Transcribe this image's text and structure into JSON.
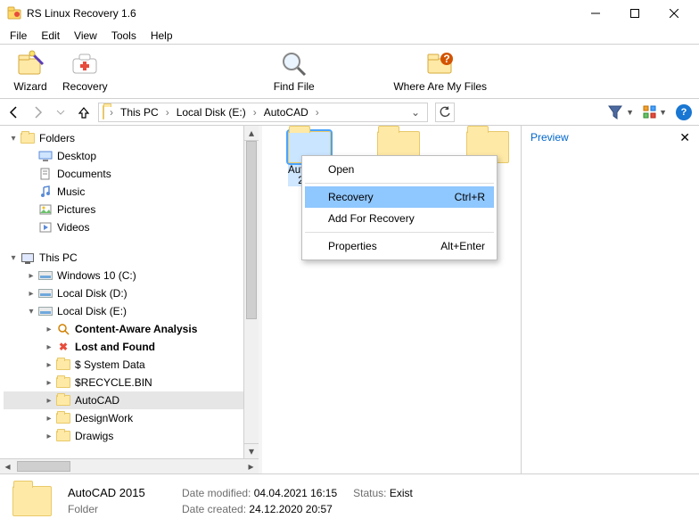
{
  "title": "RS Linux Recovery 1.6",
  "menubar": [
    "File",
    "Edit",
    "View",
    "Tools",
    "Help"
  ],
  "toolbar": [
    {
      "id": "wizard",
      "label": "Wizard"
    },
    {
      "id": "recovery",
      "label": "Recovery"
    },
    {
      "id": "findfile",
      "label": "Find File"
    },
    {
      "id": "wherefiles",
      "label": "Where Are My Files"
    }
  ],
  "breadcrumb": [
    "This PC",
    "Local Disk (E:)",
    "AutoCAD"
  ],
  "tree": {
    "folders_root": "Folders",
    "quick": [
      "Desktop",
      "Documents",
      "Music",
      "Pictures",
      "Videos"
    ],
    "thispc": "This PC",
    "drives": [
      "Windows 10 (C:)",
      "Local Disk (D:)",
      "Local Disk (E:)"
    ],
    "e_children": [
      {
        "label": "Content-Aware Analysis",
        "bold": true,
        "icon": "search"
      },
      {
        "label": "Lost and Found",
        "bold": true,
        "icon": "x"
      },
      {
        "label": "$ System Data",
        "icon": "folder"
      },
      {
        "label": "$RECYCLE.BIN",
        "icon": "folder"
      },
      {
        "label": "AutoCAD",
        "icon": "folder",
        "selected": true
      },
      {
        "label": "DesignWork",
        "icon": "folder"
      },
      {
        "label": "Drawigs",
        "icon": "folder"
      }
    ]
  },
  "thumbs": [
    {
      "label": "AutoCAD\n2015",
      "selected": true
    },
    {
      "label": ""
    },
    {
      "label": ""
    }
  ],
  "context_menu": {
    "items": [
      {
        "label": "Open",
        "shortcut": ""
      },
      {
        "sep": true
      },
      {
        "label": "Recovery",
        "shortcut": "Ctrl+R",
        "highlight": true
      },
      {
        "label": "Add For Recovery",
        "shortcut": ""
      },
      {
        "sep": true
      },
      {
        "label": "Properties",
        "shortcut": "Alt+Enter"
      }
    ]
  },
  "preview": {
    "title": "Preview"
  },
  "status": {
    "name": "AutoCAD 2015",
    "type": "Folder",
    "modified_label": "Date modified:",
    "modified": "04.04.2021 16:15",
    "created_label": "Date created:",
    "created": "24.12.2020 20:57",
    "status_label": "Status:",
    "status": "Exist"
  }
}
